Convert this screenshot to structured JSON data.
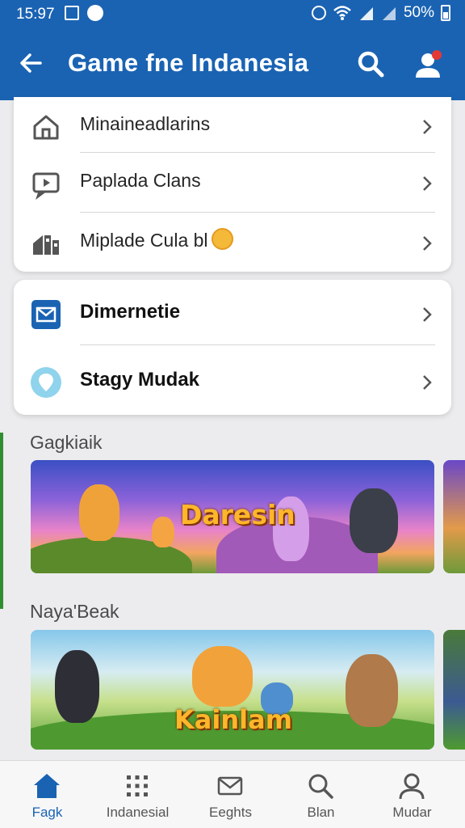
{
  "status_bar": {
    "time": "15:97",
    "battery": "50%"
  },
  "app_bar": {
    "title": "Game fne Indanesia"
  },
  "menu_group_1": [
    {
      "label": "Minaineadlarins",
      "icon": "home-icon"
    },
    {
      "label": "Paplada Clans",
      "icon": "video-icon"
    },
    {
      "label": "Miplade Cula bl",
      "icon": "building-icon",
      "has_emoji": true
    }
  ],
  "menu_group_2": [
    {
      "label": "Dimernetie",
      "icon": "mail-icon"
    },
    {
      "label": "Stagy Mudak",
      "icon": "location-icon"
    }
  ],
  "sections": [
    {
      "title": "Gagkiaik",
      "banner_text": "Daresin"
    },
    {
      "title": "Naya'Beak",
      "banner_text": "Kainlam"
    }
  ],
  "bottom_nav": [
    {
      "label": "Fagk",
      "icon": "home-icon",
      "active": true
    },
    {
      "label": "Indanesial",
      "icon": "grid-icon",
      "active": false
    },
    {
      "label": "Eeghts",
      "icon": "mail-icon",
      "active": false
    },
    {
      "label": "Blan",
      "icon": "search-icon",
      "active": false
    },
    {
      "label": "Mudar",
      "icon": "person-icon",
      "active": false
    }
  ],
  "colors": {
    "primary": "#1a63b3",
    "background": "#ececee",
    "mail_icon_bg": "#1a63b3",
    "location_icon_bg": "#8fd3ec"
  }
}
